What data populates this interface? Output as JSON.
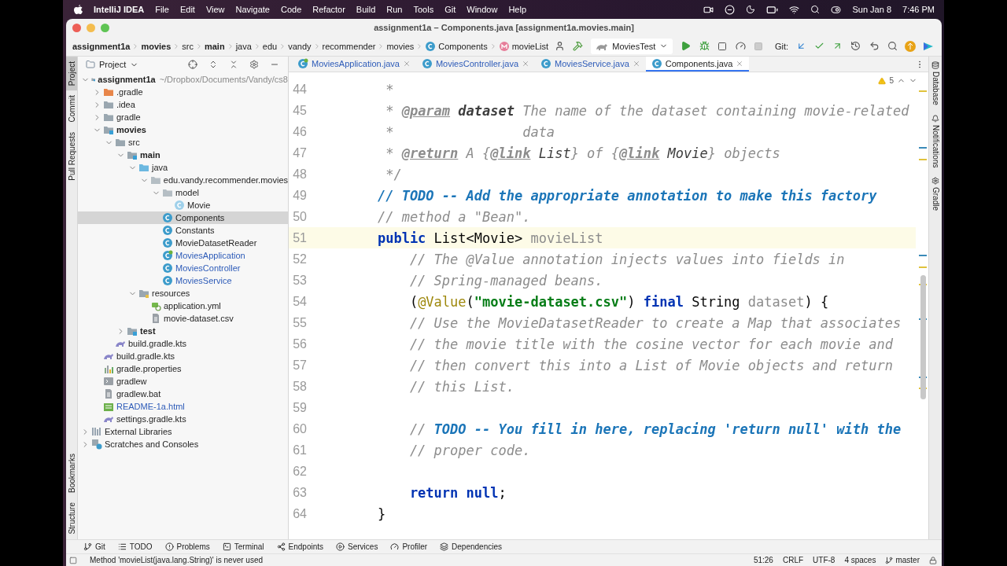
{
  "menu_bar": {
    "app": "IntelliJ IDEA",
    "items": [
      "File",
      "Edit",
      "View",
      "Navigate",
      "Code",
      "Refactor",
      "Build",
      "Run",
      "Tools",
      "Git",
      "Window",
      "Help"
    ],
    "date": "Sun Jan 8",
    "time": "7:46 PM"
  },
  "window": {
    "title": "assignment1a – Components.java [assignment1a.movies.main]"
  },
  "breadcrumbs": [
    {
      "label": "assignment1a",
      "kind": "module"
    },
    {
      "label": "movies",
      "kind": "module"
    },
    {
      "label": "src",
      "kind": "folder"
    },
    {
      "label": "main",
      "kind": "source-set"
    },
    {
      "label": "java",
      "kind": "folder"
    },
    {
      "label": "edu",
      "kind": "folder"
    },
    {
      "label": "vandy",
      "kind": "folder"
    },
    {
      "label": "recommender",
      "kind": "folder"
    },
    {
      "label": "movies",
      "kind": "folder"
    },
    {
      "label": "Components",
      "kind": "class"
    },
    {
      "label": "movieList",
      "kind": "method"
    }
  ],
  "toolbar": {
    "run_config": "MoviesTest",
    "git_label": "Git:"
  },
  "left_strip": {
    "top": [
      {
        "label": "Project",
        "selected": true
      },
      {
        "label": "Commit",
        "selected": false
      },
      {
        "label": "Pull Requests",
        "selected": false
      }
    ],
    "bottom": [
      {
        "label": "Bookmarks",
        "selected": false
      },
      {
        "label": "Structure",
        "selected": false
      }
    ]
  },
  "right_strip": [
    "Database",
    "Notifications",
    "Gradle"
  ],
  "project": {
    "title": "Project",
    "tree": [
      {
        "name": "assignment1a",
        "note": "~/Dropbox/Documents/Vandy/cs8",
        "kind": "module",
        "expanded": true,
        "selected": false,
        "modified": false,
        "children": [
          {
            "name": ".gradle",
            "kind": "excluded",
            "expanded": false,
            "selected": false,
            "modified": false
          },
          {
            "name": ".idea",
            "kind": "folder",
            "expanded": false,
            "selected": false,
            "modified": false
          },
          {
            "name": "gradle",
            "kind": "folder",
            "expanded": false,
            "selected": false,
            "modified": false
          },
          {
            "name": "movies",
            "kind": "module",
            "expanded": true,
            "selected": false,
            "modified": false,
            "children": [
              {
                "name": "src",
                "kind": "folder",
                "expanded": true,
                "selected": false,
                "modified": false,
                "children": [
                  {
                    "name": "main",
                    "kind": "source-set",
                    "expanded": true,
                    "selected": false,
                    "modified": false,
                    "children": [
                      {
                        "name": "java",
                        "kind": "source-root",
                        "expanded": true,
                        "selected": false,
                        "modified": false,
                        "children": [
                          {
                            "name": "edu.vandy.recommender.movies",
                            "kind": "package",
                            "expanded": true,
                            "selected": false,
                            "modified": false,
                            "children": [
                              {
                                "name": "model",
                                "kind": "package",
                                "expanded": true,
                                "selected": false,
                                "modified": false,
                                "children": [
                                  {
                                    "name": "Movie",
                                    "kind": "record",
                                    "selected": false,
                                    "modified": false
                                  }
                                ]
                              },
                              {
                                "name": "Components",
                                "kind": "class",
                                "selected": true,
                                "modified": false
                              },
                              {
                                "name": "Constants",
                                "kind": "class",
                                "selected": false,
                                "modified": false
                              },
                              {
                                "name": "MovieDatasetReader",
                                "kind": "class",
                                "selected": false,
                                "modified": false
                              },
                              {
                                "name": "MoviesApplication",
                                "kind": "spring-class",
                                "selected": false,
                                "modified": true
                              },
                              {
                                "name": "MoviesController",
                                "kind": "class",
                                "selected": false,
                                "modified": true
                              },
                              {
                                "name": "MoviesService",
                                "kind": "class",
                                "selected": false,
                                "modified": true
                              }
                            ]
                          }
                        ]
                      },
                      {
                        "name": "resources",
                        "kind": "resources-root",
                        "expanded": true,
                        "selected": false,
                        "modified": false,
                        "children": [
                          {
                            "name": "application.yml",
                            "kind": "yml",
                            "selected": false,
                            "modified": false
                          },
                          {
                            "name": "movie-dataset.csv",
                            "kind": "text",
                            "selected": false,
                            "modified": false
                          }
                        ]
                      }
                    ]
                  },
                  {
                    "name": "test",
                    "kind": "source-set",
                    "expanded": false,
                    "selected": false,
                    "modified": false
                  }
                ]
              },
              {
                "name": "build.gradle.kts",
                "kind": "gradle-kts",
                "selected": false,
                "modified": false
              }
            ]
          },
          {
            "name": "build.gradle.kts",
            "kind": "gradle-kts",
            "selected": false,
            "modified": false
          },
          {
            "name": "gradle.properties",
            "kind": "properties",
            "selected": false,
            "modified": false
          },
          {
            "name": "gradlew",
            "kind": "script",
            "selected": false,
            "modified": false
          },
          {
            "name": "gradlew.bat",
            "kind": "text",
            "selected": false,
            "modified": false
          },
          {
            "name": "README-1a.html",
            "kind": "html",
            "selected": false,
            "modified": true
          },
          {
            "name": "settings.gradle.kts",
            "kind": "gradle-kts",
            "selected": false,
            "modified": false
          }
        ]
      },
      {
        "name": "External Libraries",
        "kind": "library",
        "expanded": false,
        "selected": false,
        "modified": false
      },
      {
        "name": "Scratches and Consoles",
        "kind": "scratches",
        "expanded": false,
        "selected": false,
        "modified": false
      }
    ]
  },
  "tabs": [
    {
      "label": "MoviesApplication.java",
      "kind": "spring-class",
      "selected": false,
      "modified": true
    },
    {
      "label": "MoviesController.java",
      "kind": "class",
      "selected": false,
      "modified": true
    },
    {
      "label": "MoviesService.java",
      "kind": "class",
      "selected": false,
      "modified": true
    },
    {
      "label": "Components.java",
      "kind": "class",
      "selected": true,
      "modified": false
    }
  ],
  "editor": {
    "warnings": "5",
    "lines": [
      {
        "number": "44",
        "current": false,
        "segments": [
          {
            "kind": "comment",
            "text": "     *"
          }
        ]
      },
      {
        "number": "45",
        "current": false,
        "segments": [
          {
            "kind": "comment",
            "text": "     * "
          },
          {
            "kind": "doc-tag",
            "text": "@param"
          },
          {
            "kind": "doc-value",
            "text": " dataset"
          },
          {
            "kind": "comment",
            "text": " The name of the dataset containing movie-related"
          }
        ]
      },
      {
        "number": "46",
        "current": false,
        "segments": [
          {
            "kind": "comment",
            "text": "     *                data"
          }
        ]
      },
      {
        "number": "47",
        "current": false,
        "segments": [
          {
            "kind": "comment",
            "text": "     * "
          },
          {
            "kind": "doc-tag",
            "text": "@return"
          },
          {
            "kind": "comment",
            "text": " A {"
          },
          {
            "kind": "doc-tag",
            "text": "@link"
          },
          {
            "kind": "doc-ref",
            "text": " List"
          },
          {
            "kind": "comment",
            "text": "} of {"
          },
          {
            "kind": "doc-tag",
            "text": "@link"
          },
          {
            "kind": "doc-ref",
            "text": " Movie"
          },
          {
            "kind": "comment",
            "text": "} objects"
          }
        ]
      },
      {
        "number": "48",
        "current": false,
        "segments": [
          {
            "kind": "comment",
            "text": "     */"
          }
        ]
      },
      {
        "number": "49",
        "current": false,
        "segments": [
          {
            "kind": "todo",
            "text": "    // TODO -- Add the appropriate annotation to make this factory"
          }
        ]
      },
      {
        "number": "50",
        "current": false,
        "segments": [
          {
            "kind": "comment",
            "text": "    // method a \"Bean\"."
          }
        ]
      },
      {
        "number": "51",
        "current": true,
        "segments": [
          {
            "kind": "keyword",
            "text": "    public"
          },
          {
            "kind": "plain",
            "text": " List<Movie> "
          },
          {
            "kind": "unused",
            "text": "movieList"
          }
        ]
      },
      {
        "number": "52",
        "current": false,
        "segments": [
          {
            "kind": "comment",
            "text": "        // The @Value annotation injects values into fields in"
          }
        ]
      },
      {
        "number": "53",
        "current": false,
        "segments": [
          {
            "kind": "comment",
            "text": "        // Spring-managed beans."
          }
        ]
      },
      {
        "number": "54",
        "current": false,
        "segments": [
          {
            "kind": "plain",
            "text": "        ("
          },
          {
            "kind": "annotation",
            "text": "@Value"
          },
          {
            "kind": "plain",
            "text": "("
          },
          {
            "kind": "string",
            "text": "\"movie-dataset.csv\""
          },
          {
            "kind": "plain",
            "text": ") "
          },
          {
            "kind": "keyword",
            "text": "final"
          },
          {
            "kind": "plain",
            "text": " String "
          },
          {
            "kind": "unused",
            "text": "dataset"
          },
          {
            "kind": "plain",
            "text": ") {"
          }
        ]
      },
      {
        "number": "55",
        "current": false,
        "segments": [
          {
            "kind": "comment",
            "text": "        // Use the MovieDatasetReader to create a Map that associates"
          }
        ]
      },
      {
        "number": "56",
        "current": false,
        "segments": [
          {
            "kind": "comment",
            "text": "        // the movie title with the cosine vector for each movie and"
          }
        ]
      },
      {
        "number": "57",
        "current": false,
        "segments": [
          {
            "kind": "comment",
            "text": "        // then convert this into a List of Movie objects and return"
          }
        ]
      },
      {
        "number": "58",
        "current": false,
        "segments": [
          {
            "kind": "comment",
            "text": "        // this List."
          }
        ]
      },
      {
        "number": "59",
        "current": false
      },
      {
        "number": "60",
        "current": false,
        "segments": [
          {
            "kind": "comment",
            "text": "        // "
          },
          {
            "kind": "todo",
            "text": "TODO -- You fill in here, replacing 'return null' with the"
          }
        ]
      },
      {
        "number": "61",
        "current": false,
        "segments": [
          {
            "kind": "comment",
            "text": "        // proper code."
          }
        ]
      },
      {
        "number": "62",
        "current": false
      },
      {
        "number": "63",
        "current": false,
        "segments": [
          {
            "kind": "keyword",
            "text": "        return null"
          },
          {
            "kind": "plain",
            "text": ";"
          }
        ]
      },
      {
        "number": "64",
        "current": false,
        "segments": [
          {
            "kind": "plain",
            "text": "    }"
          }
        ]
      }
    ]
  },
  "tool_tabs": [
    {
      "label": "Git",
      "kind": "git"
    },
    {
      "label": "TODO",
      "kind": "todo"
    },
    {
      "label": "Problems",
      "kind": "problems"
    },
    {
      "label": "Terminal",
      "kind": "terminal"
    },
    {
      "label": "Endpoints",
      "kind": "endpoints"
    },
    {
      "label": "Services",
      "kind": "services"
    },
    {
      "label": "Profiler",
      "kind": "profiler"
    },
    {
      "label": "Dependencies",
      "kind": "dependencies"
    }
  ],
  "status_bar": {
    "message": "Method 'movieList(java.lang.String)' is never used",
    "items": [
      "51:26",
      "CRLF",
      "UTF-8",
      "4 spaces"
    ],
    "branch": "master"
  }
}
